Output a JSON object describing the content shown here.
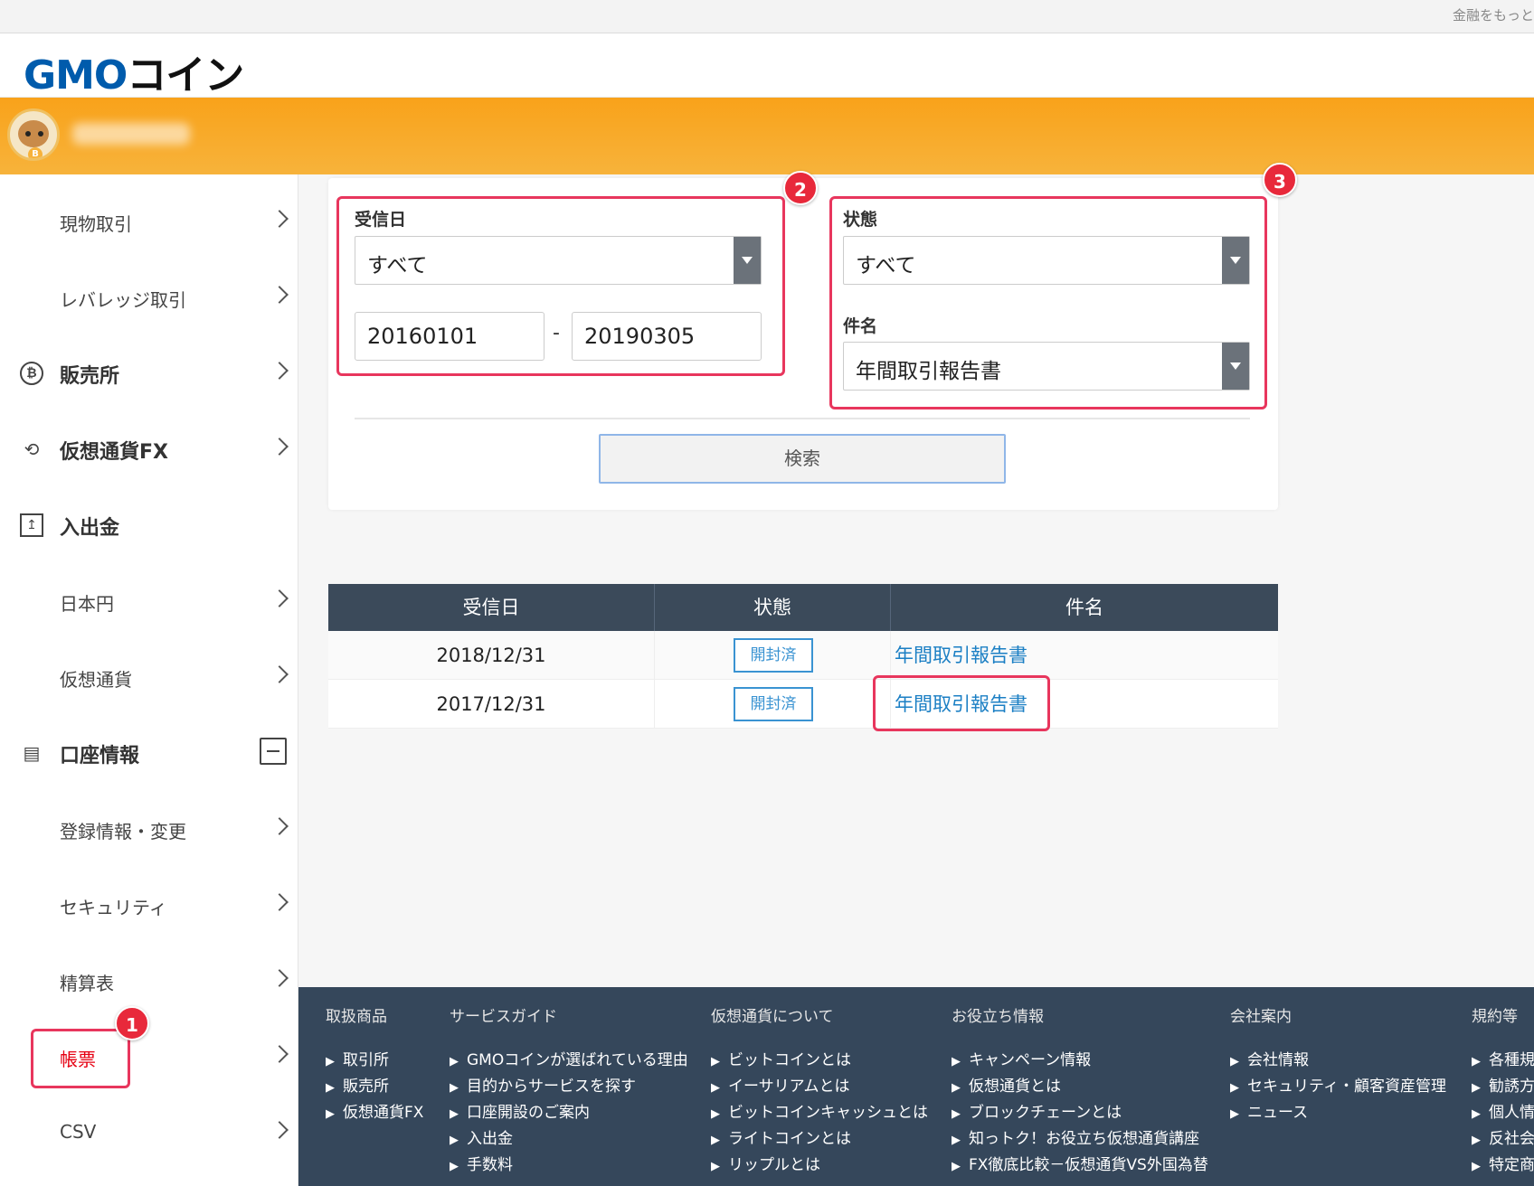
{
  "topbar": {
    "tagline": "金融をもっと"
  },
  "header": {
    "logo_gmo": "GMO",
    "logo_coin": "コイン"
  },
  "sidebar": {
    "items": [
      {
        "label": "現物取引",
        "type": "sub"
      },
      {
        "label": "レバレッジ取引",
        "type": "sub"
      },
      {
        "label": "販売所",
        "type": "cat",
        "icon": "bitcoin-icon"
      },
      {
        "label": "仮想通貨FX",
        "type": "cat",
        "icon": "exchange-icon"
      },
      {
        "label": "入出金",
        "type": "cat",
        "icon": "deposit-icon"
      },
      {
        "label": "日本円",
        "type": "sub"
      },
      {
        "label": "仮想通貨",
        "type": "sub"
      },
      {
        "label": "口座情報",
        "type": "cat",
        "icon": "account-icon"
      },
      {
        "label": "登録情報・変更",
        "type": "sub"
      },
      {
        "label": "セキュリティ",
        "type": "sub"
      },
      {
        "label": "精算表",
        "type": "sub"
      },
      {
        "label": "帳票",
        "type": "sub",
        "active": true
      },
      {
        "label": "CSV",
        "type": "sub"
      }
    ]
  },
  "search": {
    "received_label": "受信日",
    "received_select": "すべて",
    "date_from": "20160101",
    "date_to": "20190305",
    "date_sep": "-",
    "status_label": "状態",
    "status_select": "すべて",
    "subject_label": "件名",
    "subject_select": "年間取引報告書",
    "search_button": "検索"
  },
  "annotations": {
    "b1": "1",
    "b2": "2",
    "b3": "3"
  },
  "results": {
    "headers": [
      "受信日",
      "状態",
      "件名"
    ],
    "rows": [
      {
        "date": "2018/12/31",
        "status": "開封済",
        "subject": "年間取引報告書"
      },
      {
        "date": "2017/12/31",
        "status": "開封済",
        "subject": "年間取引報告書"
      }
    ]
  },
  "footer": {
    "columns": [
      {
        "heading": "取扱商品",
        "links": [
          "取引所",
          "販売所",
          "仮想通貨FX"
        ]
      },
      {
        "heading": "サービスガイド",
        "links": [
          "GMOコインが選ばれている理由",
          "目的からサービスを探す",
          "口座開設のご案内",
          "入出金",
          "手数料"
        ]
      },
      {
        "heading": "仮想通貨について",
        "links": [
          "ビットコインとは",
          "イーサリアムとは",
          "ビットコインキャッシュとは",
          "ライトコインとは",
          "リップルとは"
        ]
      },
      {
        "heading": "お役立ち情報",
        "links": [
          "キャンペーン情報",
          "仮想通貨とは",
          "ブロックチェーンとは",
          "知っトク！お役立ち仮想通貨講座",
          "FX徹底比較－仮想通貨VS外国為替"
        ]
      },
      {
        "heading": "会社案内",
        "links": [
          "会社情報",
          "セキュリティ・顧客資産管理",
          "ニュース"
        ]
      },
      {
        "heading": "規約等",
        "links": [
          "各種規",
          "勧誘方",
          "個人情",
          "反社会",
          "特定商"
        ]
      }
    ]
  },
  "colors": {
    "brand_orange": "#f9a21a",
    "brand_blue": "#005bac",
    "highlight": "#e8365d",
    "link": "#1b7fc4"
  }
}
